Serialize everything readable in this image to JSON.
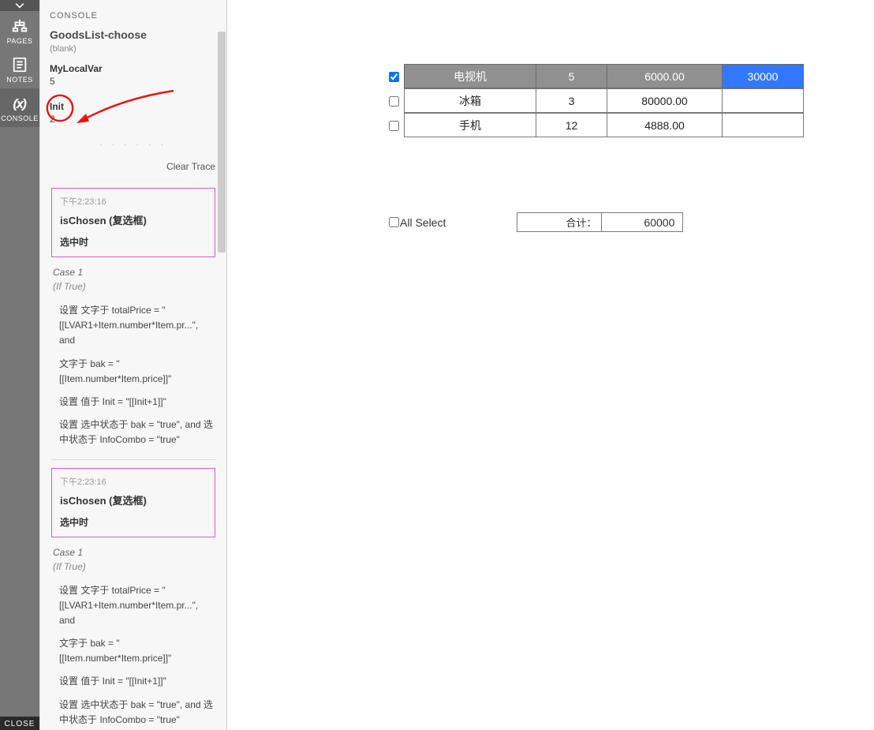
{
  "rail": {
    "pages": "PAGES",
    "notes": "NOTES",
    "console": "CONSOLE",
    "close": "CLOSE"
  },
  "console": {
    "header": "CONSOLE",
    "page_title": "GoodsList-choose",
    "blank": "(blank)",
    "vars": [
      {
        "name": "MyLocalVar",
        "value": "5"
      },
      {
        "name": "Init",
        "value": "2"
      }
    ],
    "clear_trace": "Clear Trace",
    "traces": [
      {
        "time": "下午2:23:16",
        "title": "isChosen (复选框)",
        "event": "选中时",
        "case_label": "Case 1",
        "condition": "(If True)",
        "actions": [
          "设置 文字于 totalPrice = \"[[LVAR1+Item.number*Item.pr...\", and",
          "文字于 bak = \"[[Item.number*Item.price]]\"",
          "设置 值于 Init = \"[[Init+1]]\"",
          "设置 选中状态于 bak = \"true\", and 选中状态于 InfoCombo = \"true\""
        ]
      },
      {
        "time": "下午2:23:16",
        "title": "isChosen (复选框)",
        "event": "选中时",
        "case_label": "Case 1",
        "condition": "(If True)",
        "actions": [
          "设置 文字于 totalPrice = \"[[LVAR1+Item.number*Item.pr...\", and",
          "文字于 bak = \"[[Item.number*Item.price]]\"",
          "设置 值于 Init = \"[[Init+1]]\"",
          "设置 选中状态于 bak = \"true\", and 选中状态于 InfoCombo = \"true\""
        ]
      }
    ]
  },
  "goods": {
    "rows": [
      {
        "checked": true,
        "name": "电视机",
        "qty": "5",
        "price": "6000.00",
        "total": "30000"
      },
      {
        "checked": false,
        "name": "冰箱",
        "qty": "3",
        "price": "80000.00",
        "total": ""
      },
      {
        "checked": false,
        "name": "手机",
        "qty": "12",
        "price": "4888.00",
        "total": ""
      }
    ]
  },
  "footer": {
    "all_select_checked": false,
    "all_select_label": "All Select",
    "sum_label": "合计：",
    "sum_value": "60000"
  }
}
